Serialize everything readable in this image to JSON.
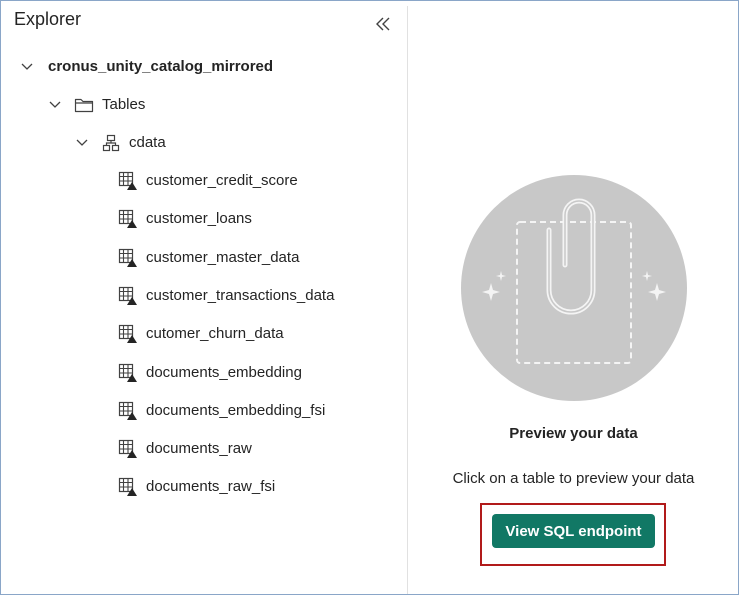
{
  "explorer": {
    "title": "Explorer",
    "collapse_icon": "double-chevron-left-icon",
    "root": {
      "label": "cronus_unity_catalog_mirrored",
      "expanded": true
    },
    "folder": {
      "label": "Tables",
      "icon": "folder-icon",
      "expanded": true
    },
    "schema": {
      "label": "cdata",
      "icon": "schema-icon",
      "expanded": true
    },
    "tables": [
      {
        "label": "customer_credit_score"
      },
      {
        "label": "customer_loans"
      },
      {
        "label": "customer_master_data"
      },
      {
        "label": "customer_transactions_data"
      },
      {
        "label": "cutomer_churn_data"
      },
      {
        "label": "documents_embedding"
      },
      {
        "label": "documents_embedding_fsi"
      },
      {
        "label": "documents_raw"
      },
      {
        "label": "documents_raw_fsi"
      }
    ],
    "table_icon": "mirrored-table-icon"
  },
  "preview": {
    "illustration": "paperclip-document-illustration",
    "title": "Preview your data",
    "subtitle": "Click on a table to preview your data",
    "button_label": "View SQL endpoint"
  },
  "colors": {
    "accent": "#117865",
    "highlight_border": "#b11a1a",
    "illustration_bg": "#c8c8c8"
  }
}
